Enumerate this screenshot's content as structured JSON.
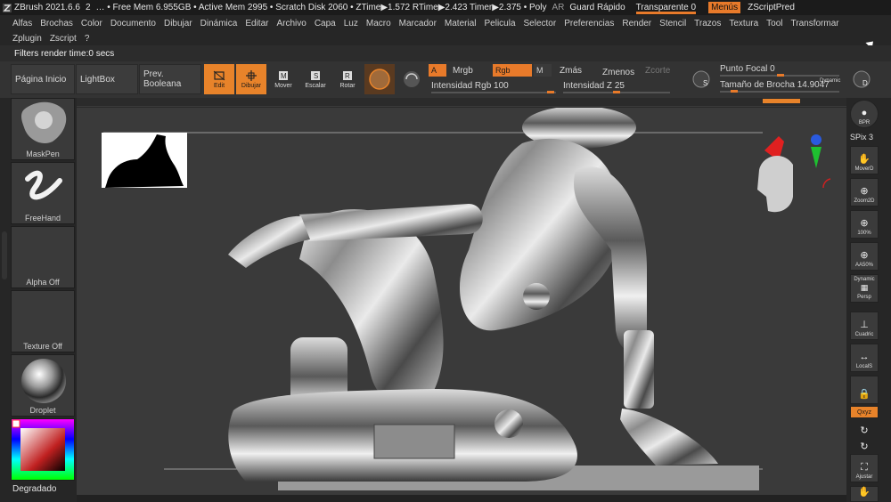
{
  "titlebar": {
    "app": "ZBrush 2021.6.6",
    "counter": "2",
    "stats": "… • Free Mem 6.955GB • Active Mem 2995 • Scratch Disk 2060 • ZTime▶1.572 RTime▶2.423 Timer▶2.375 • Poly",
    "ar": "AR",
    "quick_save": "Guard Rápido",
    "transparent": "Transparente 0",
    "menus": "Menús",
    "zscript_pred": "ZScriptPred"
  },
  "menus": [
    "Alfas",
    "Brochas",
    "Color",
    "Documento",
    "Dibujar",
    "Dinámica",
    "Editar",
    "Archivo",
    "Capa",
    "Luz",
    "Macro",
    "Marcador",
    "Material",
    "Pelicula",
    "Selector",
    "Preferencias",
    "Render",
    "Stencil",
    "Trazos",
    "Textura",
    "Tool",
    "Transformar"
  ],
  "menus2": [
    "Zplugin",
    "Zscript",
    "?"
  ],
  "notification": "Filters render time:0 secs",
  "toolbar": {
    "home": "Página Inicio",
    "lightbox": "LightBox",
    "boolean": "Prev. Booleana",
    "edit": "Edit",
    "draw": "Dibujar",
    "move": "Mover",
    "scale": "Escalar",
    "rotate": "Rotar",
    "a_toggle": "A",
    "mrgb": "Mrgb",
    "rgb": "Rgb",
    "m": "M",
    "zadd": "Zmás",
    "zsub": "Zmenos",
    "zcut": "Zcorte",
    "rgb_intensity": "Intensidad Rgb 100",
    "z_intensity": "Intensidad Z 25",
    "focal_point": "Punto Focal 0",
    "brush_size": "Tamaño de Brocha 14.9047",
    "dynamic": "Dynamic",
    "s_label": "S",
    "d_label": "D"
  },
  "left": {
    "brush": "MaskPen",
    "stroke": "FreeHand",
    "alpha": "Alpha Off",
    "texture": "Texture Off",
    "material": "Droplet",
    "gradient": "Degradado"
  },
  "right": {
    "bpr": "BPR",
    "spix": "SPix 3",
    "move": "MoverD",
    "zoom": "Zoom2D",
    "p100": "100%",
    "aahalf": "AA50%",
    "dynamic": "Dynamic",
    "persp": "Persp",
    "floor": "Cuadric",
    "local": "LocalS",
    "xyz": "Qxyz",
    "frame": "Ajustar"
  },
  "colors": {
    "accent": "#e8832a",
    "bg": "#2a2a2a"
  }
}
